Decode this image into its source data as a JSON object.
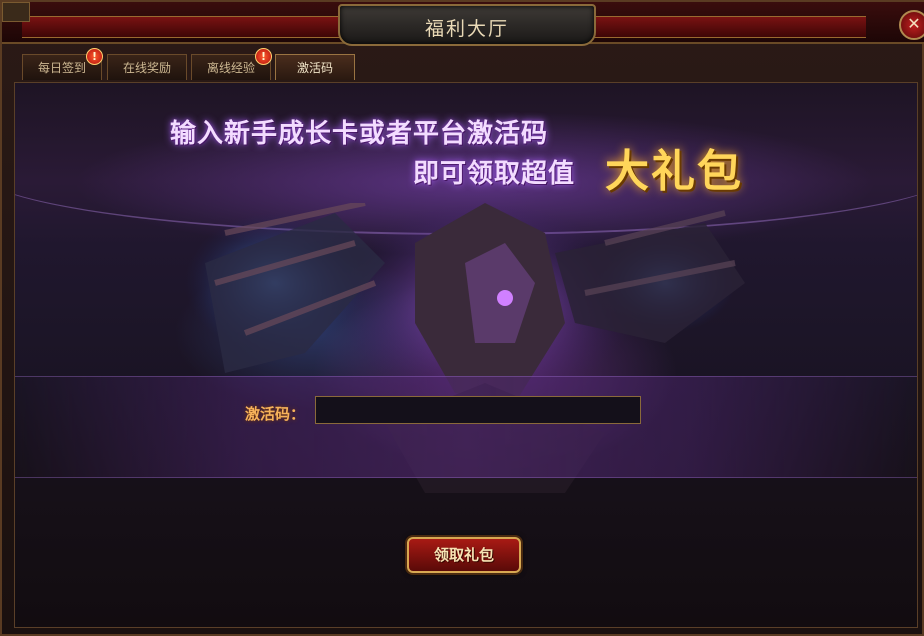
{
  "window": {
    "title": "福利大厅",
    "close_icon": "close-icon"
  },
  "tabs": [
    {
      "label": "每日签到",
      "badge": "!",
      "active": false
    },
    {
      "label": "在线奖励",
      "badge": "",
      "active": false
    },
    {
      "label": "离线经验",
      "badge": "!",
      "active": false
    },
    {
      "label": "激活码",
      "badge": "",
      "active": true
    }
  ],
  "banner": {
    "line1": "输入新手成长卡或者平台激活码",
    "line2": "即可领取超值",
    "gift_text": "大礼包"
  },
  "form": {
    "code_label": "激活码：",
    "code_value": "",
    "claim_button": "领取礼包"
  },
  "colors": {
    "accent_gold": "#ffd65a",
    "label_orange": "#f6b25a",
    "button_red": "#a81a14",
    "frame_border": "#8a6a3a"
  }
}
